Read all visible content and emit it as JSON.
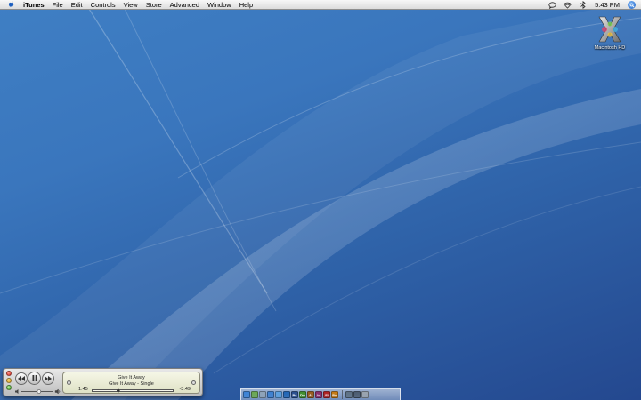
{
  "menubar": {
    "items": [
      {
        "label": "iTunes"
      },
      {
        "label": "File"
      },
      {
        "label": "Edit"
      },
      {
        "label": "Controls"
      },
      {
        "label": "View"
      },
      {
        "label": "Store"
      },
      {
        "label": "Advanced"
      },
      {
        "label": "Window"
      },
      {
        "label": "Help"
      }
    ],
    "clock": "5:43 PM",
    "status_icons": [
      "speech-bubble-icon",
      "wifi-icon",
      "bluetooth-icon",
      "spotlight-icon"
    ]
  },
  "desktop": {
    "hd_label": "Macintosh HD",
    "wallpaper_colors": [
      "#3f7fc4",
      "#24488f"
    ]
  },
  "mini_player": {
    "title": "Give It Away",
    "subtitle": "Give It Away - Single",
    "elapsed": "1:45",
    "remaining": "-3:49",
    "progress": 0.32,
    "volume": 0.55
  },
  "dock": {
    "items": [
      {
        "name": "finder-icon",
        "color": "#3b82d6",
        "text": ""
      },
      {
        "name": "itunes-icon",
        "color": "#6aa84f",
        "text": ""
      },
      {
        "name": "mail-icon",
        "color": "#8fa3b8",
        "text": ""
      },
      {
        "name": "safari-icon",
        "color": "#3b7fd0",
        "text": ""
      },
      {
        "name": "ichat-icon",
        "color": "#5aa0e0",
        "text": ""
      },
      {
        "name": "firefox-icon",
        "color": "#1f64b5",
        "text": ""
      },
      {
        "name": "photoshop-icon",
        "color": "#2a4f8f",
        "text": "Ps"
      },
      {
        "name": "dreamweaver-icon",
        "color": "#3f8f2a",
        "text": "Dw"
      },
      {
        "name": "illustrator-icon",
        "color": "#9a5a1a",
        "text": "Ai"
      },
      {
        "name": "indesign-icon",
        "color": "#8a2a6a",
        "text": "Id"
      },
      {
        "name": "flash-icon",
        "color": "#b02020",
        "text": "Fl"
      },
      {
        "name": "fireworks-icon",
        "color": "#c87a10",
        "text": "Fw"
      }
    ],
    "extras": [
      {
        "name": "applications-folder-icon",
        "color": "#5c6f82"
      },
      {
        "name": "documents-folder-icon",
        "color": "#4a5a6e"
      },
      {
        "name": "trash-icon",
        "color": "#9aa3ad"
      }
    ]
  }
}
